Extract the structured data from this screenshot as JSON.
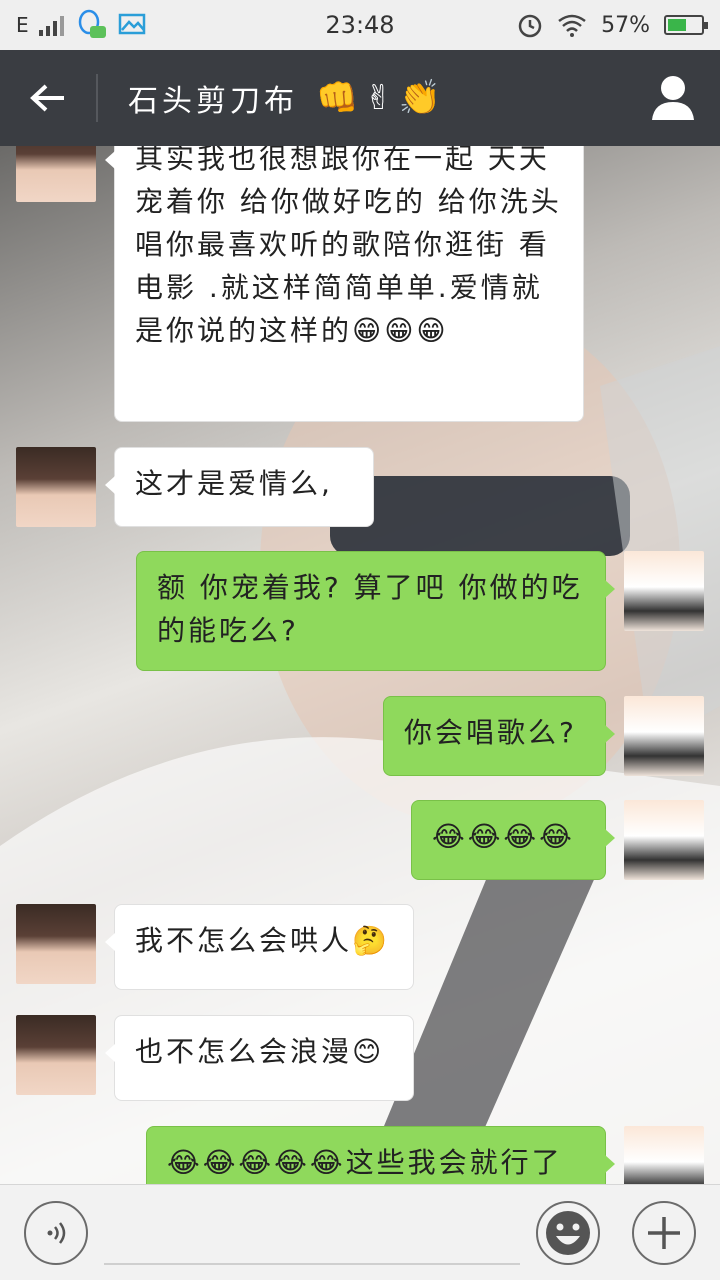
{
  "status_bar": {
    "carrier": "E",
    "time": "23:48",
    "battery_percent": "57%",
    "battery_level": 0.57,
    "icons": [
      "signal-icon",
      "qq-icon",
      "gallery-icon",
      "alarm-icon",
      "wifi-icon",
      "battery-icon"
    ]
  },
  "header": {
    "title": "石头剪刀布",
    "title_emojis": "👊✌👏",
    "back_icon": "back-arrow-icon",
    "profile_icon": "person-icon"
  },
  "messages": [
    {
      "side": "left",
      "text": "其实我也很想跟你在一起 天天宠着你 给你做好吃的 给你洗头 唱你最喜欢听的歌陪你逛街 看电影 .就这样简简单单.爱情就是你说的这样的😁😁😁"
    },
    {
      "side": "left",
      "text": "这才是爱情么,"
    },
    {
      "side": "right",
      "text": "额 你宠着我? 算了吧 你做的吃的能吃么?"
    },
    {
      "side": "right",
      "text": "你会唱歌么?"
    },
    {
      "side": "right",
      "text": "😂😂😂😂"
    },
    {
      "side": "left",
      "text": "我不怎么会哄人🤔"
    },
    {
      "side": "left",
      "text": "也不怎么会浪漫😊"
    },
    {
      "side": "right",
      "text": "😂😂😂😂😂这些我会就行了"
    }
  ],
  "input_bar": {
    "voice_icon": "voice-icon",
    "emoji_icon": "smiley-icon",
    "add_icon": "plus-icon"
  },
  "colors": {
    "nav_bg": "#3a3d42",
    "my_bubble": "#8fd95c",
    "friend_bubble": "#ffffff"
  }
}
